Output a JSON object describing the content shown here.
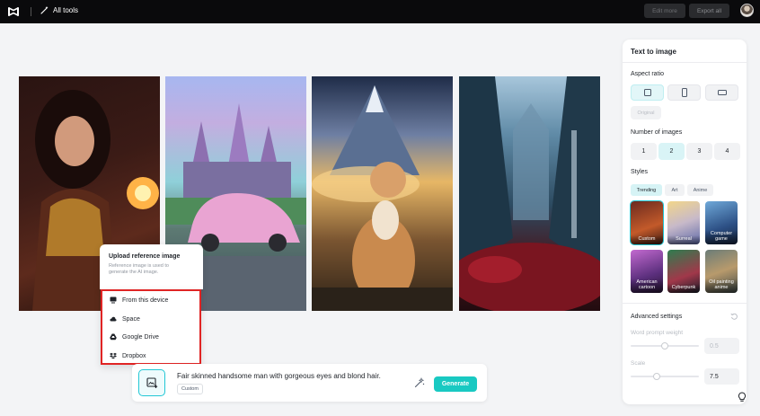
{
  "topbar": {
    "all_tools": "All tools",
    "edit_more": "Edit more",
    "export_all": "Export all"
  },
  "upload": {
    "title": "Upload reference image",
    "description": "Reference image is used to generate the AI image.",
    "options": [
      {
        "label": "From this device",
        "icon": "device-icon"
      },
      {
        "label": "Space",
        "icon": "cloud-icon"
      },
      {
        "label": "Google Drive",
        "icon": "google-drive-icon"
      },
      {
        "label": "Dropbox",
        "icon": "dropbox-icon"
      }
    ]
  },
  "prompt": {
    "text": "Fair skinned handsome man with gorgeous eyes and blond hair.",
    "style_chip": "Custom",
    "generate": "Generate"
  },
  "panel": {
    "title": "Text to image",
    "aspect_ratio_label": "Aspect ratio",
    "original": "Original",
    "number_label": "Number of images",
    "numbers": [
      "1",
      "2",
      "3",
      "4"
    ],
    "selected_number": "2",
    "styles_label": "Styles",
    "style_tabs": [
      "Trending",
      "Art",
      "Anime"
    ],
    "styles": [
      "Custom",
      "Surreal",
      "Computer game",
      "American cartoon",
      "Cyberpunk",
      "Oil painting anime"
    ],
    "advanced_label": "Advanced settings",
    "word_prompt_weight_label": "Word prompt weight",
    "word_prompt_weight_value": "0.5",
    "word_prompt_weight_level": 0.5,
    "scale_label": "Scale",
    "scale_value": "7.5",
    "scale_level": 0.38
  },
  "colors": {
    "accent": "#19c9c2",
    "highlight_border": "#e02424"
  }
}
